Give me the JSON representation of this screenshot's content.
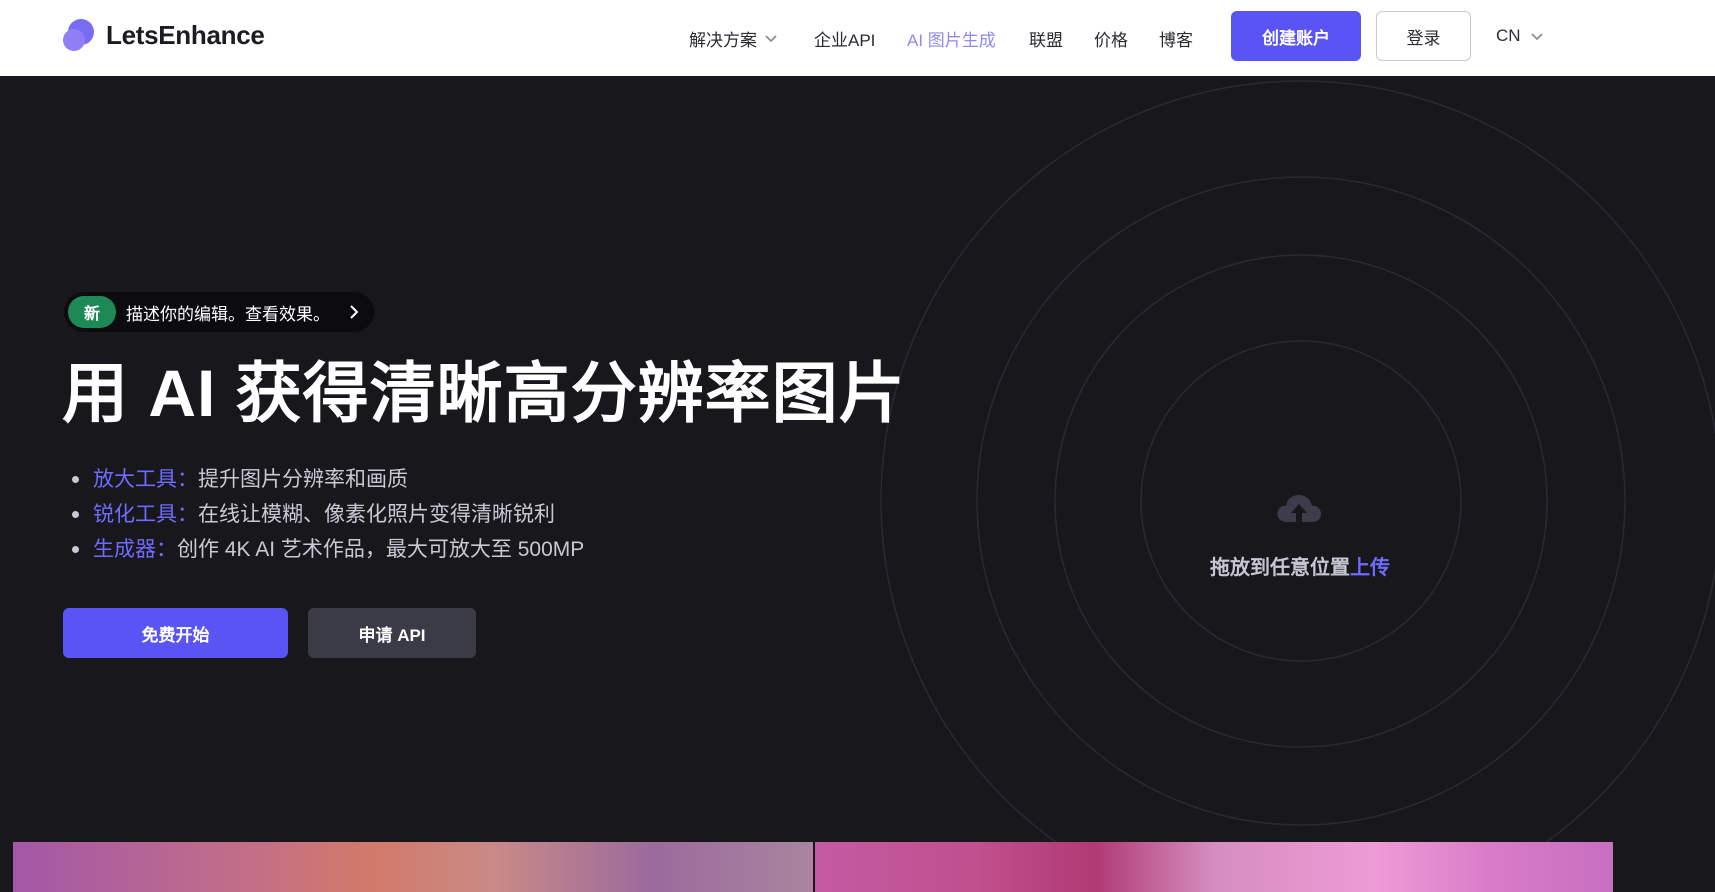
{
  "header": {
    "logo_text": "LetsEnhance",
    "nav": [
      {
        "label": "解决方案",
        "has_dropdown": true
      },
      {
        "label": "企业API"
      },
      {
        "label": "AI 图片生成",
        "active": true
      },
      {
        "label": "联盟"
      },
      {
        "label": "价格"
      },
      {
        "label": "博客"
      }
    ],
    "create_account": "创建账户",
    "login": "登录",
    "language": "CN"
  },
  "hero": {
    "badge_new": "新",
    "badge_text": "描述你的编辑。查看效果。",
    "title": "用 AI 获得清晰高分辨率图片",
    "features": [
      {
        "key": "放大工具：",
        "text": "提升图片分辨率和画质"
      },
      {
        "key": "锐化工具：",
        "text": "在线让模糊、像素化照片变得清晰锐利"
      },
      {
        "key": "生成器：",
        "text": "创作 4K AI 艺术作品，最大可放大至 500MP"
      }
    ],
    "start_button": "免费开始",
    "api_button": "申请 API"
  },
  "upload": {
    "text": "拖放到任意位置",
    "link": "上传",
    "icon": "cloud-upload-icon"
  },
  "colors": {
    "accent": "#5a54f5",
    "accent_text": "#6e6bff",
    "background": "#17171c",
    "badge_green": "#1d8a55"
  }
}
